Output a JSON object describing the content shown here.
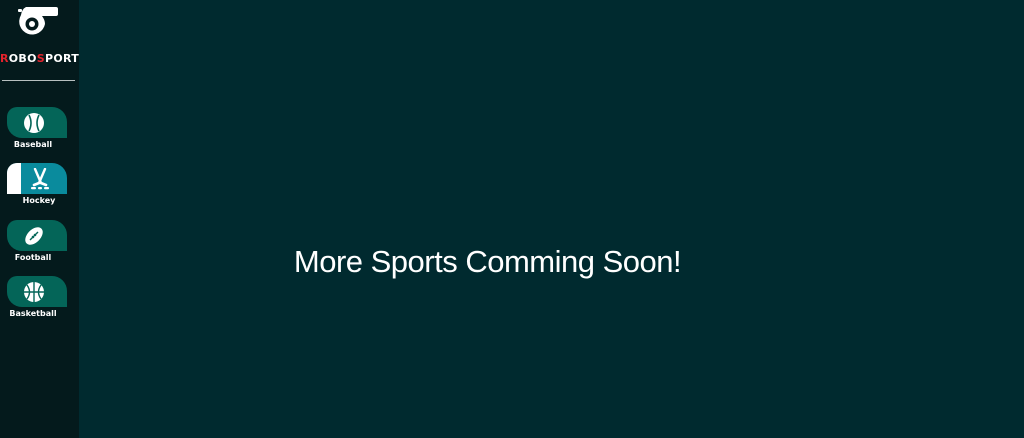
{
  "brand": {
    "prefix_r": "R",
    "part1": "OBO",
    "prefix_s": "S",
    "part2": "PORTS",
    "logo_icon": "whistle-icon"
  },
  "nav": {
    "items": [
      {
        "label": "Baseball",
        "icon": "baseball-icon",
        "active": false
      },
      {
        "label": "Hockey",
        "icon": "hockey-sticks-icon",
        "active": true
      },
      {
        "label": "Football",
        "icon": "football-icon",
        "active": false
      },
      {
        "label": "Basketball",
        "icon": "basketball-icon",
        "active": false
      }
    ]
  },
  "main": {
    "message": "More Sports Comming Soon!"
  },
  "colors": {
    "sidebar_bg": "#041a1c",
    "main_bg": "#002a2f",
    "tab": "#046558",
    "tab_active": "#0a8b9d",
    "brand_accent": "#e3232c"
  }
}
